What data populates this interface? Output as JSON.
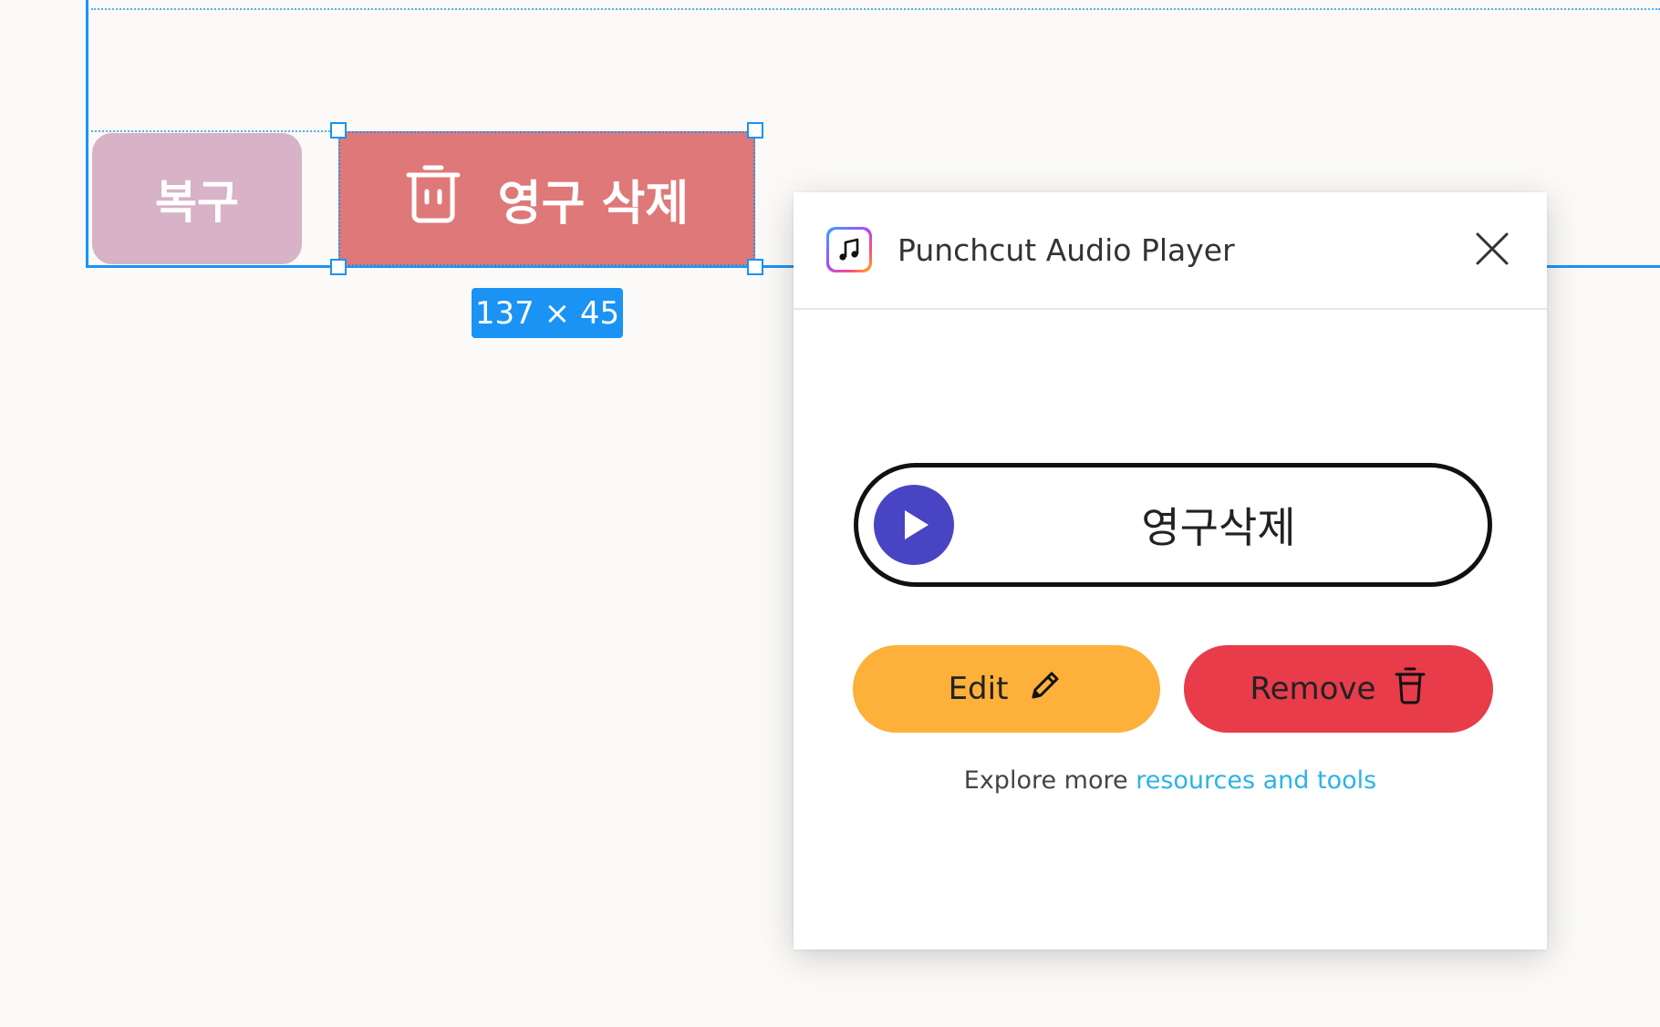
{
  "canvas": {
    "restore_button_label": "복구",
    "delete_button_label": "영구 삭제",
    "size_tag": "137 × 45",
    "selection_color": "#1a93f5",
    "restore_color": "#d8b2c6",
    "delete_color": "#df7878"
  },
  "plugin": {
    "title": "Punchcut Audio Player",
    "app_icon": "music-note-icon",
    "close_icon": "close-icon",
    "player": {
      "label": "영구삭제",
      "play_icon": "play-icon",
      "play_color": "#4844c4"
    },
    "edit_label": "Edit",
    "edit_icon": "pencil-icon",
    "edit_color": "#fdb03a",
    "remove_label": "Remove",
    "remove_icon": "trash-icon",
    "remove_color": "#e83c4b",
    "footer_prefix": "Explore more",
    "footer_link": "resources and tools",
    "link_color": "#2bb3e8"
  }
}
